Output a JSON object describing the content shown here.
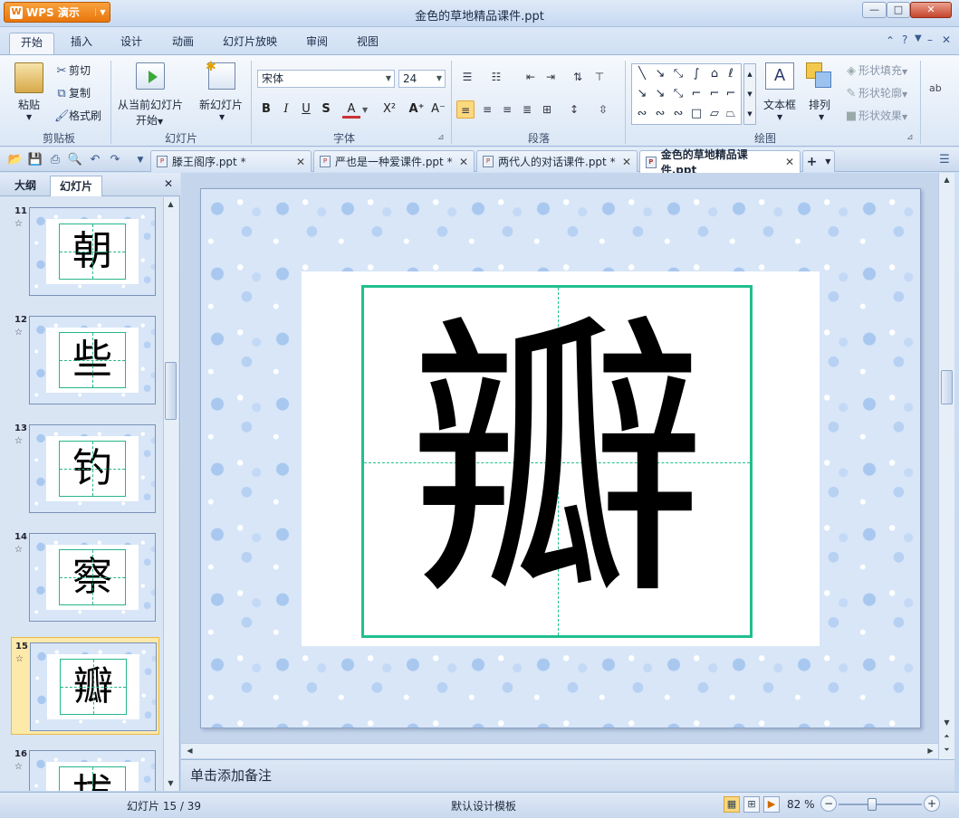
{
  "app": {
    "button_label": "WPS 演示",
    "window_title": "金色的草地精品课件.ppt"
  },
  "menu": {
    "tabs": [
      "开始",
      "插入",
      "设计",
      "动画",
      "幻灯片放映",
      "审阅",
      "视图"
    ],
    "active": "开始"
  },
  "ribbon": {
    "clipboard": {
      "paste": "粘贴",
      "cut": "剪切",
      "copy": "复制",
      "format_painter": "格式刷",
      "group": "剪贴板"
    },
    "slides": {
      "from_current": "从当前幻灯片",
      "start": "开始",
      "new_slide": "新幻灯片",
      "group": "幻灯片"
    },
    "font": {
      "name": "宋体",
      "size": "24",
      "bold": "B",
      "italic": "I",
      "underline": "U",
      "shadow": "S",
      "color": "A",
      "group": "字体"
    },
    "paragraph": {
      "group": "段落"
    },
    "drawing": {
      "textbox": "文本框",
      "arrange": "排列",
      "shape_fill": "形状填充",
      "shape_outline": "形状轮廓",
      "shape_effect": "形状效果",
      "group": "绘图"
    }
  },
  "doc_tabs": [
    {
      "label": "滕王阁序.ppt *"
    },
    {
      "label": "严也是一种爱课件.ppt *"
    },
    {
      "label": "两代人的对话课件.ppt *"
    },
    {
      "label": "金色的草地精品课件.ppt"
    }
  ],
  "left_panel": {
    "tab_outline": "大纲",
    "tab_slides": "幻灯片"
  },
  "thumbnails": [
    {
      "num": "11",
      "char": "朝"
    },
    {
      "num": "12",
      "char": "些"
    },
    {
      "num": "13",
      "char": "钓"
    },
    {
      "num": "14",
      "char": "察"
    },
    {
      "num": "15",
      "char": "瓣"
    },
    {
      "num": "16",
      "char": "拔"
    }
  ],
  "selected_slide": "15",
  "slide": {
    "character": "瓣"
  },
  "notes_placeholder": "单击添加备注",
  "status": {
    "slide_counter": "幻灯片 15 / 39",
    "template": "默认设计模板",
    "zoom": "82 %"
  },
  "colors": {
    "accent_green": "#20bf8e",
    "selection": "#fbd97d",
    "wps_orange": "#e8760c"
  }
}
